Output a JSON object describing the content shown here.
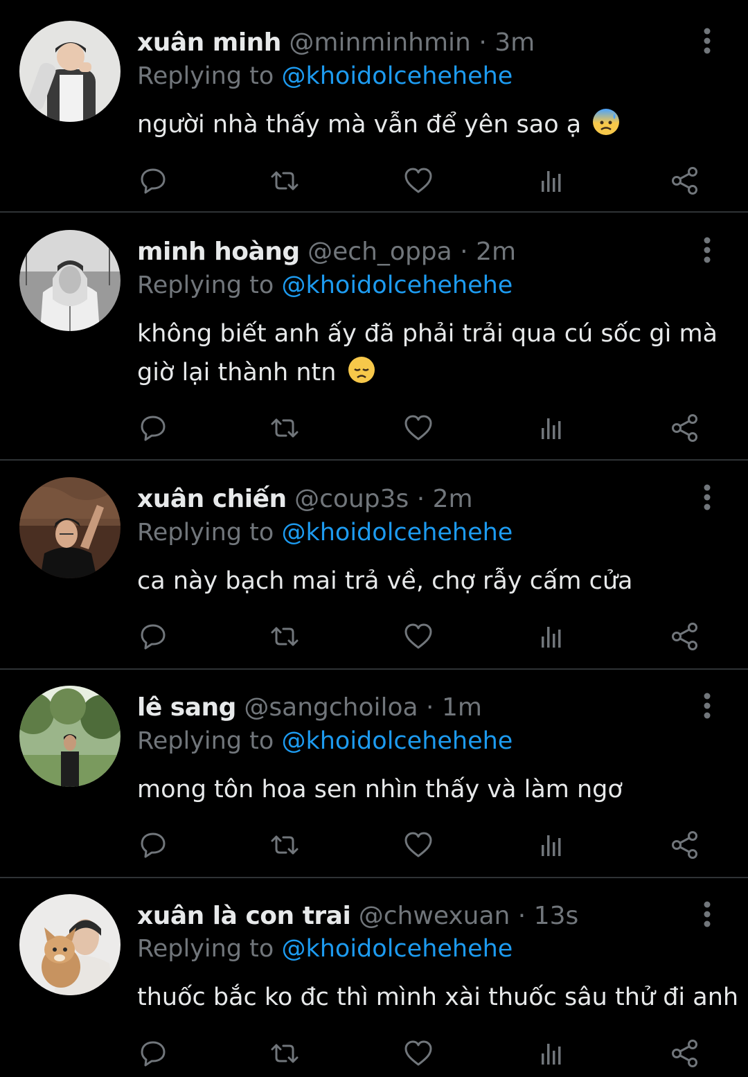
{
  "colors": {
    "background": "#000000",
    "text": "#e7e9ea",
    "muted": "#71767b",
    "link": "#1d9bf0",
    "divider": "#2f3336"
  },
  "reply_prefix": "Replying to",
  "dot": "·",
  "icons": [
    "reply-icon",
    "retweet-icon",
    "like-icon",
    "views-icon",
    "share-icon",
    "more-icon"
  ],
  "tweets": [
    {
      "display_name": "xuân minh",
      "handle": "@minminhmin",
      "time": "3m",
      "reply_to": "@khoidolcehehehe",
      "text": "người nhà thấy mà vẫn để yên sao ạ",
      "emoji": "anxious-face-emoji"
    },
    {
      "display_name": "minh hoàng",
      "handle": "@ech_oppa",
      "time": "2m",
      "reply_to": "@khoidolcehehehe",
      "text": "không biết anh ấy đã phải trải qua cú sốc gì mà giờ lại thành ntn",
      "emoji": "disappointed-face-emoji"
    },
    {
      "display_name": "xuân chiến",
      "handle": "@coup3s",
      "time": "2m",
      "reply_to": "@khoidolcehehehe",
      "text": "ca này bạch mai trả về, chợ rẫy cấm cửa",
      "emoji": ""
    },
    {
      "display_name": "lê sang",
      "handle": "@sangchoiloa",
      "time": "1m",
      "reply_to": "@khoidolcehehehe",
      "text": "mong tôn hoa sen nhìn thấy và làm ngơ",
      "emoji": ""
    },
    {
      "display_name": "xuân là con trai",
      "handle": "@chwexuan",
      "time": "13s",
      "reply_to": "@khoidolcehehehe",
      "text": "thuốc bắc ko đc thì mình xài thuốc sâu thử đi anh",
      "emoji": ""
    }
  ]
}
